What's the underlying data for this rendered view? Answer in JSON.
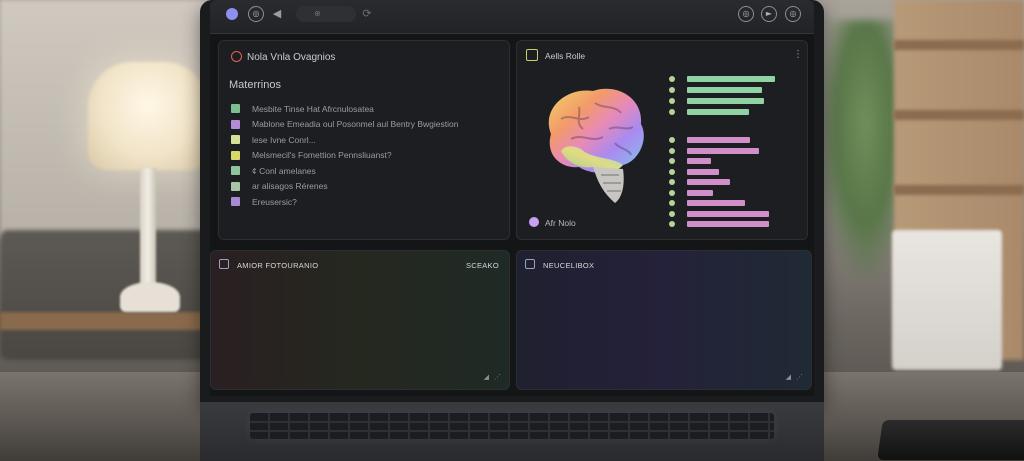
{
  "notes_panel": {
    "title": "Nola Vnla Ovagnios",
    "section": "Materrinos",
    "items": [
      {
        "text": "Mesbite Tinse Hat Afrcnulosatea",
        "color": "#7fbf8f"
      },
      {
        "text": "Mablone Emeadia oul Posonmel aul Bentry Bwgiestion",
        "color": "#b48ad6"
      },
      {
        "text": "lese Ivne Conrl...",
        "color": "#d7e09a"
      },
      {
        "text": "Melsmecil's Fomettion Pennsliuanst?",
        "color": "#d9d66a"
      },
      {
        "text": "¢ Conl amelanes",
        "color": "#8fc79b"
      },
      {
        "text": "ar alisagos Rérenes",
        "color": "#a7c4a6"
      },
      {
        "text": "Ereusersic?",
        "color": "#a78ad4"
      }
    ]
  },
  "brain_panel": {
    "title": "Aells Rolle",
    "footer": "Afr Nolo",
    "menu_glyph": "⋮",
    "bars_top": [
      {
        "width": 0.88,
        "color": "#8fd3a4"
      },
      {
        "width": 0.75,
        "color": "#8fd3a4"
      },
      {
        "width": 0.77,
        "color": "#8fd3a4"
      },
      {
        "width": 0.62,
        "color": "#8fd3a4"
      }
    ],
    "bars_bottom": [
      {
        "width": 0.63,
        "color": "#d18fc9"
      },
      {
        "width": 0.72,
        "color": "#d18fc9"
      },
      {
        "width": 0.24,
        "color": "#d18fc9"
      },
      {
        "width": 0.32,
        "color": "#d18fc9"
      },
      {
        "width": 0.43,
        "color": "#d18fc9"
      },
      {
        "width": 0.26,
        "color": "#d18fc9"
      },
      {
        "width": 0.58,
        "color": "#d18fc9"
      },
      {
        "width": 0.82,
        "color": "#d18fc9"
      },
      {
        "width": 0.82,
        "color": "#d18fc9"
      }
    ]
  },
  "wave_left": {
    "label": "AMIOR FOTOURANIO",
    "right_label": "SCEAKO",
    "colors": [
      "#f06a6a",
      "#f2a35e",
      "#e9d56a",
      "#a8de7c",
      "#6fd6b0",
      "#6cc9d9"
    ]
  },
  "wave_right": {
    "label": "NEUCELIBOX",
    "colors": [
      "#6b86f0",
      "#8a7bf0",
      "#c47ed8",
      "#e88fc6",
      "#9ec7ee",
      "#8fe0ee"
    ]
  },
  "toolbar": {
    "address_text": "⊕",
    "back_glyph": "◀",
    "reload_glyph": "⟳",
    "icons": [
      "◎",
      "►",
      "◎"
    ]
  }
}
